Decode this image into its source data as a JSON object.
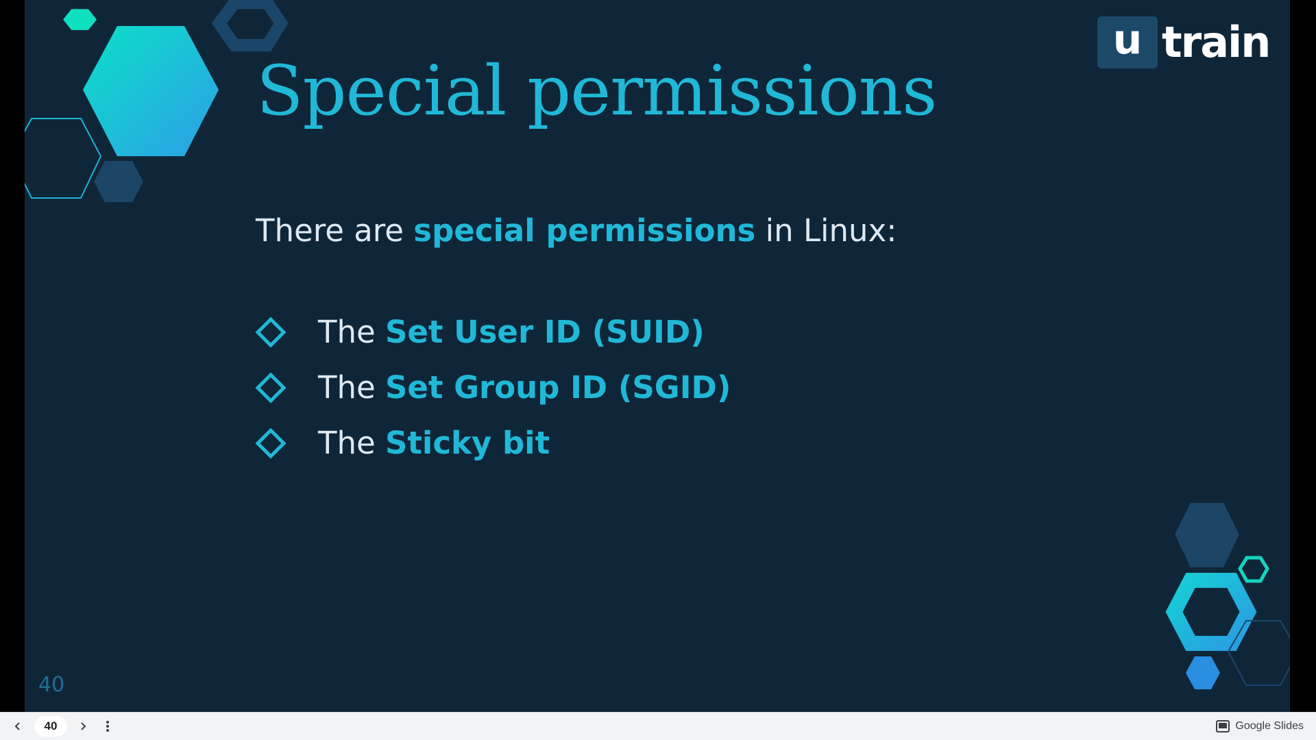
{
  "slide": {
    "title": "Special permissions",
    "intro": {
      "before": "There are ",
      "highlight": "special permissions",
      "after": " in Linux:"
    },
    "bullets": [
      {
        "prefix": "The ",
        "highlight": "Set User ID (SUID)"
      },
      {
        "prefix": "The ",
        "highlight": "Set Group ID (SGID)"
      },
      {
        "prefix": "The ",
        "highlight": "Sticky bit"
      }
    ],
    "bullet_icon": "diamond-outline-icon",
    "slide_number": "40"
  },
  "logo": {
    "box_letter": "u",
    "word": "train"
  },
  "bottom_bar": {
    "page_value": "40",
    "prev_icon": "chevron-left-icon",
    "next_icon": "chevron-right-icon",
    "menu_icon": "more-vert-icon",
    "brand_icon": "slides-icon",
    "brand_label": "Google Slides"
  },
  "colors": {
    "background": "#0f2639",
    "accent": "#21b8d8",
    "text": "#dfe9f1",
    "hex_teal": "#0fe0c2",
    "hex_blue": "#2a8fe0",
    "hex_dark": "#1d4969",
    "toolbar": "#f1f3f4"
  }
}
